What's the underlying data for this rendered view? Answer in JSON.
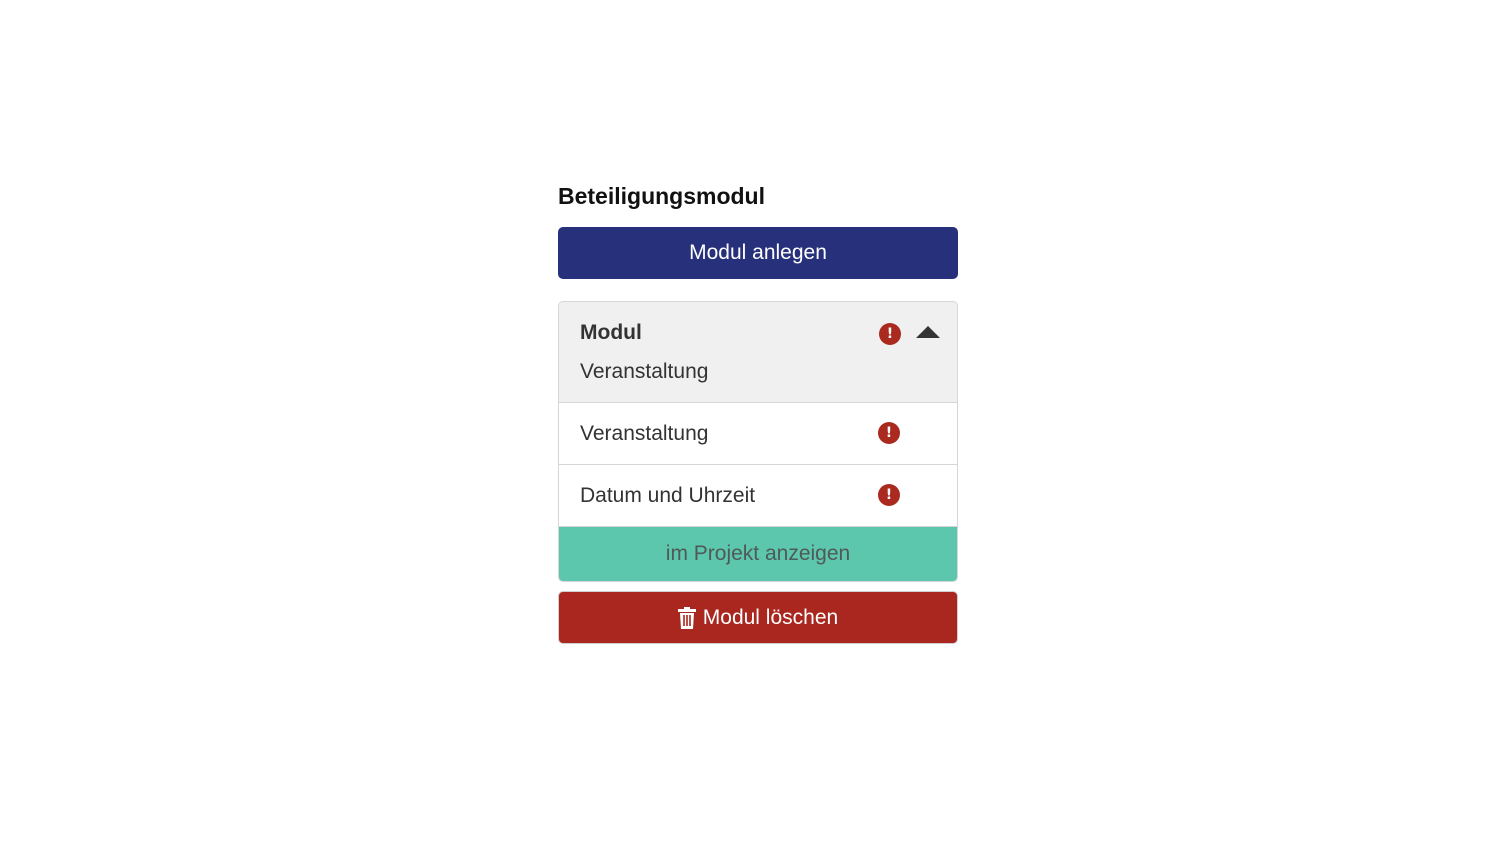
{
  "section_title": "Beteiligungsmodul",
  "create_button": {
    "label": "Modul anlegen",
    "color": "#27307a"
  },
  "module": {
    "title": "Modul",
    "subtitle": "Veranstaltung",
    "header_icons": [
      "alert-icon",
      "chevron-up-icon"
    ],
    "items": [
      {
        "label": "Veranstaltung",
        "icon": "alert-icon"
      },
      {
        "label": "Datum und Uhrzeit",
        "icon": "alert-icon"
      }
    ],
    "show_button": {
      "label": "im Projekt anzeigen",
      "color": "#5dc7ae"
    }
  },
  "delete_button": {
    "label": "Modul löschen",
    "icon": "trash-icon",
    "color": "#a9271f"
  },
  "alert_glyph": "!",
  "alert_color": "#aa2a1f"
}
